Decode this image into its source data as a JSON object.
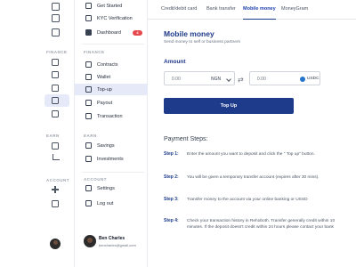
{
  "rail": {
    "sections": {
      "finance": "FINANCE",
      "earn": "EARN",
      "account": "ACCOUNT"
    },
    "icons": [
      "wallet-icon",
      "card-icon",
      "grid-icon",
      "contracts-icon",
      "payments-icon",
      "bank-icon",
      "receipt-icon",
      "savings-icon",
      "chart-icon",
      "settings-icon",
      "logout-icon"
    ]
  },
  "sidebar": {
    "top_items": [
      {
        "label": "Get Started"
      },
      {
        "label": "KYC Verification"
      },
      {
        "label": "Dashboard",
        "badge": "4"
      }
    ],
    "finance_section": "FINANCE",
    "finance_items": [
      {
        "label": "Contracts"
      },
      {
        "label": "Wallet"
      },
      {
        "label": "Top-up"
      },
      {
        "label": "Payout"
      },
      {
        "label": "Transaction"
      }
    ],
    "earn_section": "EARN",
    "earn_items": [
      {
        "label": "Savings"
      },
      {
        "label": "Investments"
      }
    ],
    "account_section": "ACCOUNT",
    "account_items": [
      {
        "label": "Settings"
      },
      {
        "label": "Log out"
      }
    ],
    "user": {
      "name": "Ben Charles",
      "email": "bencharles@gmail.com"
    }
  },
  "tabs": [
    {
      "label": "Credit/debit card"
    },
    {
      "label": "Bank transfer"
    },
    {
      "label": "Mobile money"
    },
    {
      "label": "MoneyGram"
    }
  ],
  "main": {
    "title": "Mobile money",
    "subtitle": "Send money to self or business partners",
    "amount_label": "Amount",
    "from": {
      "value": "0.00",
      "currency": "NGN"
    },
    "to": {
      "value": "0.00",
      "currency": "USDC"
    },
    "button": "Top Up",
    "steps_title": "Payment Steps:",
    "steps": [
      {
        "num": "Step 1:",
        "text": "Enter the amount you want to deposit and click the \" Top up\" button."
      },
      {
        "num": "Step 2:",
        "text": "You will be given a temporary transfer account (expires after 30 mins)."
      },
      {
        "num": "Step 3:",
        "text": "Transfer money to the account via your online banking or USSD"
      },
      {
        "num": "Step 4:",
        "text": "Check your transaction history in Rehoboth. Transfer generally credit within 10 minutes. If the deposit doesn't credit within 24 hours please contact your bank"
      }
    ]
  },
  "colors": {
    "brand": "#1e3a8a",
    "badge": "#e5484d",
    "active_bg": "#e6e9f8",
    "usdc": "#2775ca"
  }
}
